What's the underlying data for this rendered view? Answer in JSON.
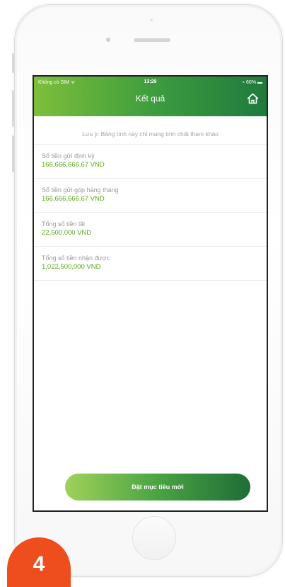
{
  "status_bar": {
    "carrier": "Không có SIM ᯤ",
    "time": "13:29",
    "battery": "⌁ 60% ▬"
  },
  "header": {
    "title": "Kết quả",
    "home_icon": "home-icon"
  },
  "note": "Lưu ý: Bảng tính này chỉ mang tính chất tham khảo",
  "results": [
    {
      "label": "Số tiền gửi định kỳ",
      "value": "166,666,666.67 VND"
    },
    {
      "label": "Số tiền gửi góp hàng tháng",
      "value": "166,666,666.67 VND"
    },
    {
      "label": "Tổng số tiền lãi",
      "value": "22,500,000 VND"
    },
    {
      "label": "Tổng số tiền nhận được",
      "value": "1,022,500,000 VND"
    }
  ],
  "cta_label": "Đặt mục tiêu mới",
  "step_badge": "4",
  "colors": {
    "header_start": "#7dbf3a",
    "header_end": "#1f7a3d",
    "value_green": "#5aa51c",
    "badge": "#ee4d1d"
  }
}
